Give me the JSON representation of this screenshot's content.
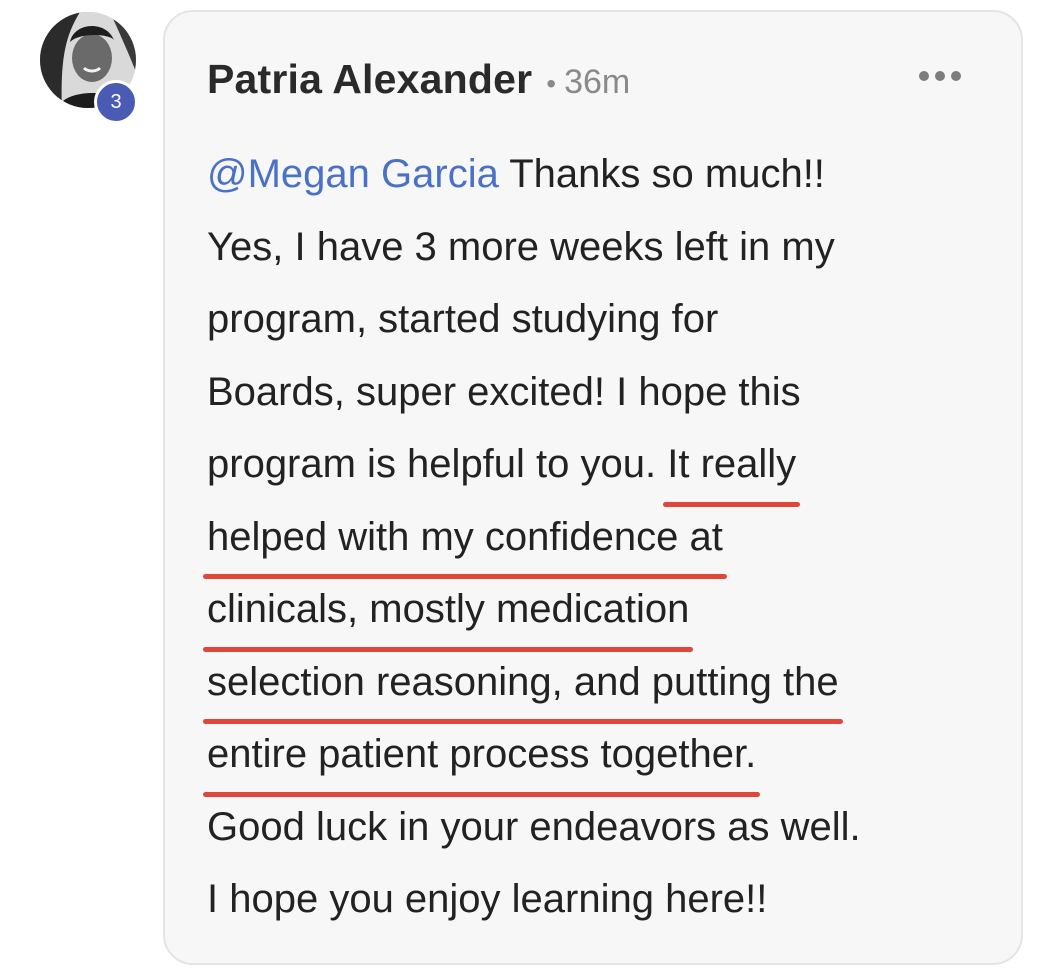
{
  "post": {
    "author": "Patria Alexander",
    "separator": "•",
    "time": "36m",
    "badge_count": "3",
    "avatar_icon": "profile-photo",
    "more_icon": "more-horizontal-icon",
    "mention": "@Megan Garcia",
    "lines": [
      " Thanks so much!!",
      "Yes, I have 3 more weeks left in my",
      "program, started studying for",
      "Boards, super excited! I hope this",
      "program is helpful to you. "
    ],
    "highlighted": [
      "It really",
      "helped with my confidence at",
      "clinicals, mostly medication",
      "selection reasoning, and putting the",
      "entire patient process together."
    ],
    "after_lines": [
      "Good luck in your endeavors as well.",
      "I hope you enjoy learning here!!"
    ]
  },
  "colors": {
    "mention": "#4a70c7",
    "underline": "#e0463a",
    "badge": "#4a5bb3",
    "card_bg": "#f7f7f7"
  }
}
